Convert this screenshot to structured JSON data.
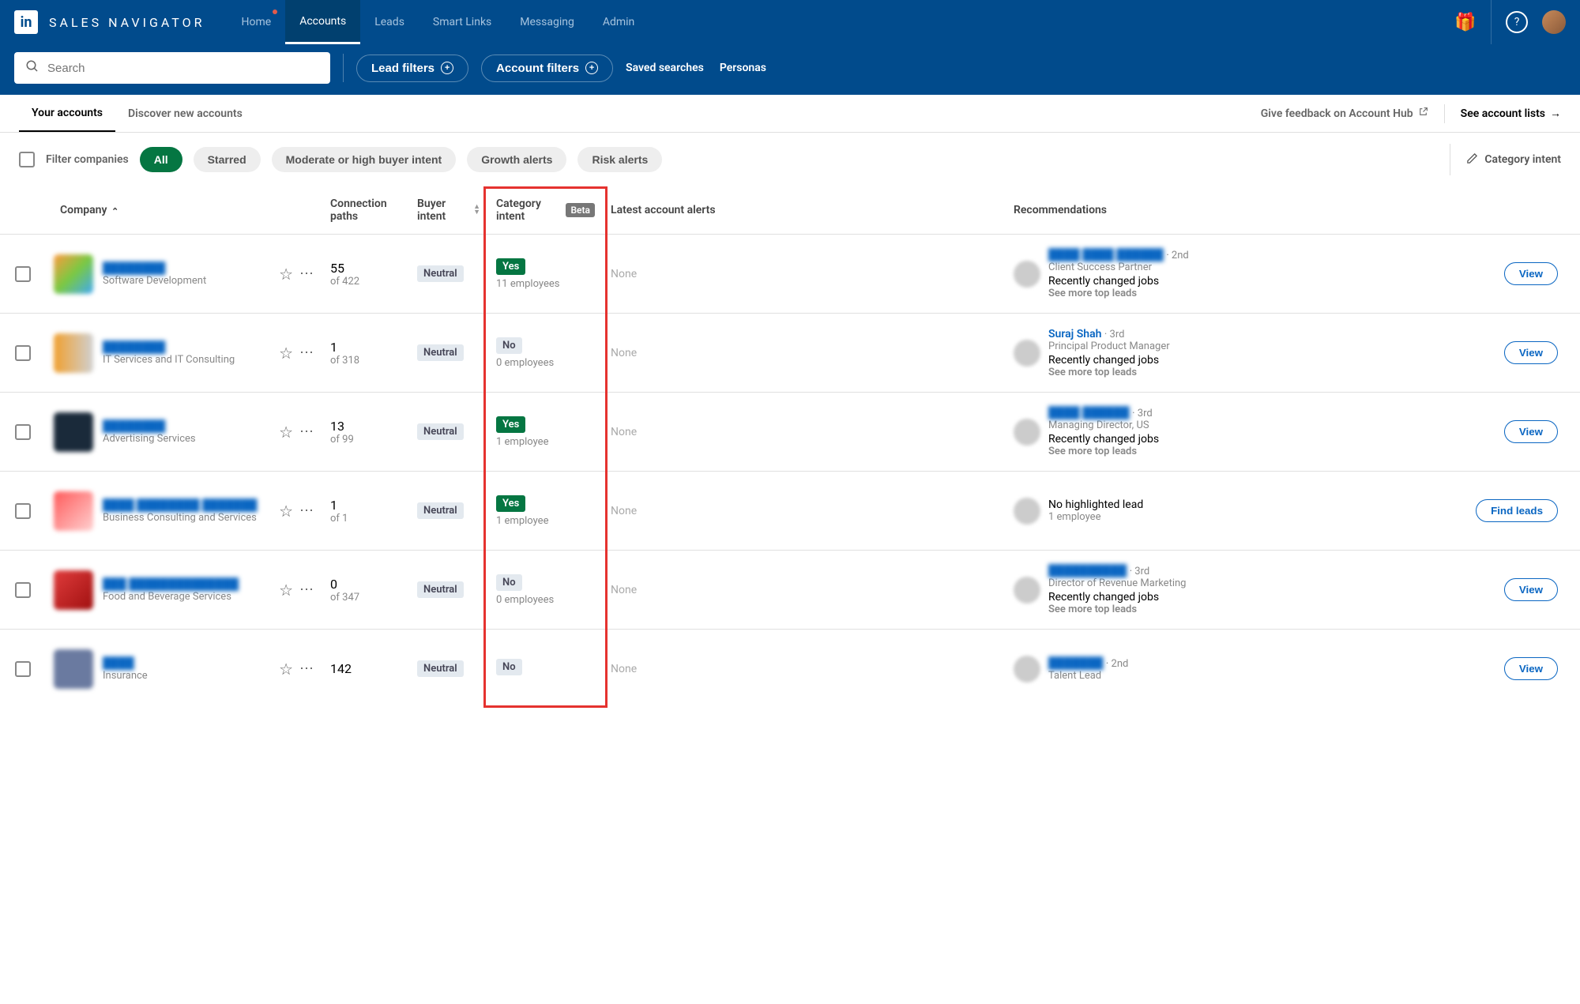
{
  "brand": "SALES NAVIGATOR",
  "nav": {
    "items": [
      "Home",
      "Accounts",
      "Leads",
      "Smart Links",
      "Messaging",
      "Admin"
    ],
    "active_index": 1
  },
  "search": {
    "placeholder": "Search",
    "lead_filters": "Lead filters",
    "account_filters": "Account filters",
    "saved_searches": "Saved searches",
    "personas": "Personas"
  },
  "subtabs": {
    "your_accounts": "Your accounts",
    "discover": "Discover new accounts",
    "feedback": "Give feedback on Account Hub",
    "see_lists": "See account lists"
  },
  "filters": {
    "label": "Filter companies",
    "chips": [
      "All",
      "Starred",
      "Moderate or high buyer intent",
      "Growth alerts",
      "Risk alerts"
    ],
    "category_intent": "Category intent"
  },
  "columns": {
    "company": "Company",
    "connection": "Connection paths",
    "buyer": "Buyer intent",
    "category": "Category intent",
    "beta": "Beta",
    "alerts": "Latest account alerts",
    "recommendations": "Recommendations"
  },
  "rows": [
    {
      "company_name": "████████",
      "industry": "Software Development",
      "logo_color": "linear-gradient(135deg,#ff9a3c,#7ac943,#3fa9f5)",
      "conn_num": "55",
      "conn_of": "of 422",
      "buyer": "Neutral",
      "category": "Yes",
      "category_sub": "11 employees",
      "alert": "None",
      "rec": {
        "name": "████ ████ ██████",
        "name_blur": true,
        "degree": "· 2nd",
        "title": "Client Success Partner",
        "change": "Recently changed jobs",
        "more": "See more top leads",
        "button": "View"
      }
    },
    {
      "company_name": "████████",
      "industry": "IT Services and IT Consulting",
      "logo_color": "linear-gradient(90deg,#f0a030,#d0d0d0)",
      "conn_num": "1",
      "conn_of": "of 318",
      "buyer": "Neutral",
      "category": "No",
      "category_sub": "0 employees",
      "alert": "None",
      "rec": {
        "name": "Suraj Shah",
        "name_blur": false,
        "degree": "· 3rd",
        "title": "Principal Product Manager",
        "change": "Recently changed jobs",
        "more": "See more top leads",
        "button": "View"
      }
    },
    {
      "company_name": "████████",
      "industry": "Advertising Services",
      "logo_color": "#1a2a3a",
      "conn_num": "13",
      "conn_of": "of 99",
      "buyer": "Neutral",
      "category": "Yes",
      "category_sub": "1 employee",
      "alert": "None",
      "rec": {
        "name": "████ ██████",
        "name_blur": true,
        "degree": "· 3rd",
        "title": "Managing Director, US",
        "change": "Recently changed jobs",
        "more": "See more top leads",
        "button": "View"
      }
    },
    {
      "company_name": "████ ████████ ███████",
      "industry": "Business Consulting and Services",
      "logo_color": "linear-gradient(135deg,#ff5a5a,#ffd0d0)",
      "conn_num": "1",
      "conn_of": "of 1",
      "buyer": "Neutral",
      "category": "Yes",
      "category_sub": "1 employee",
      "alert": "None",
      "rec": {
        "name": "No highlighted lead",
        "name_blur": false,
        "plain": true,
        "degree": "",
        "title": "1 employee",
        "change": "",
        "more": "",
        "button": "Find leads"
      }
    },
    {
      "company_name": "███ ██████████████",
      "industry": "Food and Beverage Services",
      "logo_color": "linear-gradient(135deg,#e03c3c,#a01010)",
      "conn_num": "0",
      "conn_of": "of 347",
      "buyer": "Neutral",
      "category": "No",
      "category_sub": "0 employees",
      "alert": "None",
      "rec": {
        "name": "██████████",
        "name_blur": true,
        "degree": "· 3rd",
        "title": "Director of Revenue Marketing",
        "change": "Recently changed jobs",
        "more": "See more top leads",
        "button": "View"
      }
    },
    {
      "company_name": "████",
      "industry": "Insurance",
      "logo_color": "#6a7aa0",
      "conn_num": "142",
      "conn_of": "",
      "buyer": "Neutral",
      "category": "No",
      "category_sub": "",
      "alert": "None",
      "rec": {
        "name": "███████",
        "name_blur": true,
        "degree": "· 2nd",
        "title": "Talent Lead",
        "change": "",
        "more": "",
        "button": "View"
      }
    }
  ]
}
